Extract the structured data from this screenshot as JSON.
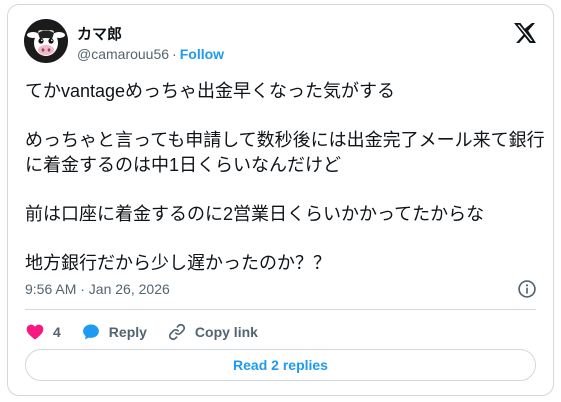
{
  "user": {
    "display_name": "カマ郎",
    "handle": "@camarouu56",
    "separator": "·",
    "follow_label": "Follow"
  },
  "tweet": {
    "paragraphs": [
      "てかvantageめっちゃ出金早くなった気がする",
      "めっちゃと言っても申請して数秒後には出金完了メール来て銀行に着金するのは中1日くらいなんだけど",
      "前は口座に着金するのに2営業日くらいかかってたからな",
      "地方銀行だから少し遅かったのか？？"
    ],
    "timestamp": "9:56 AM · Jan 26, 2026"
  },
  "actions": {
    "like_count": "4",
    "reply_label": "Reply",
    "copy_link_label": "Copy link"
  },
  "read_replies_label": "Read 2 replies",
  "colors": {
    "accent": "#1d9bf0",
    "like": "#f91880",
    "text": "#0f1419",
    "muted": "#536471",
    "border": "#cfd9de"
  }
}
